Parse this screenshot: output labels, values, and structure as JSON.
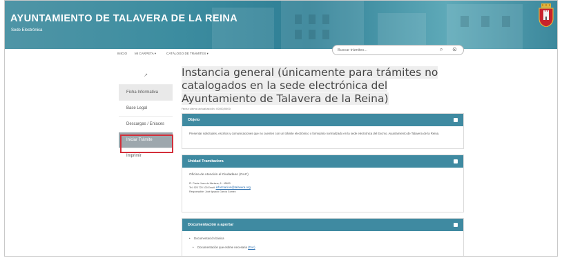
{
  "header": {
    "title": "AYUNTAMIENTO DE TALAVERA DE LA REINA",
    "subtitle": "Sede Electrónica"
  },
  "nav": {
    "items": [
      "INICIO",
      "MI CARPETA",
      "CATÁLOGO DE TRÁMITES"
    ],
    "search_placeholder": "Buscar trámites..."
  },
  "sidebar": {
    "items": [
      "Ficha Informativa",
      "Base Legal",
      "Descargas / Enlaces",
      "Iniciar Trámite",
      "Imprimir"
    ],
    "active_index": 0,
    "highlighted_index": 3
  },
  "main": {
    "title": "Instancia general (únicamente para trámites no catalogados en la sede electrónica del Ayuntamiento de Talavera de la Reina)",
    "updated": "Fecha última actualización: 00/00/0000",
    "panels": {
      "objeto": {
        "heading": "Objeto",
        "text": "Presentar solicitudes, escritos y comunicaciones que no cuenten con un trámite electrónico o formulario normalizado en la sede electrónica del Excmo. Ayuntamiento de Talavera de la Reina."
      },
      "unidad": {
        "heading": "Unidad Tramitadora",
        "office": "Oficina de Atención al Ciudadano (OAC)",
        "address": "Pl. Padre Juan de Mariana, 8 · 45600",
        "contact_prefix": "Tel. 925 720 100 Email:",
        "email": "informacion@talavera.org",
        "responsible": "Responsable: José Ignacio García Gómez"
      },
      "documentacion": {
        "heading": "Documentación a aportar",
        "items": [
          "Documentación básica",
          "Documentación que estime necesaria"
        ],
        "link": "(Doc)"
      }
    }
  },
  "colors": {
    "header": "#3d8da0",
    "panel_head": "#3f8aa1",
    "highlight": "#d32f3a"
  }
}
